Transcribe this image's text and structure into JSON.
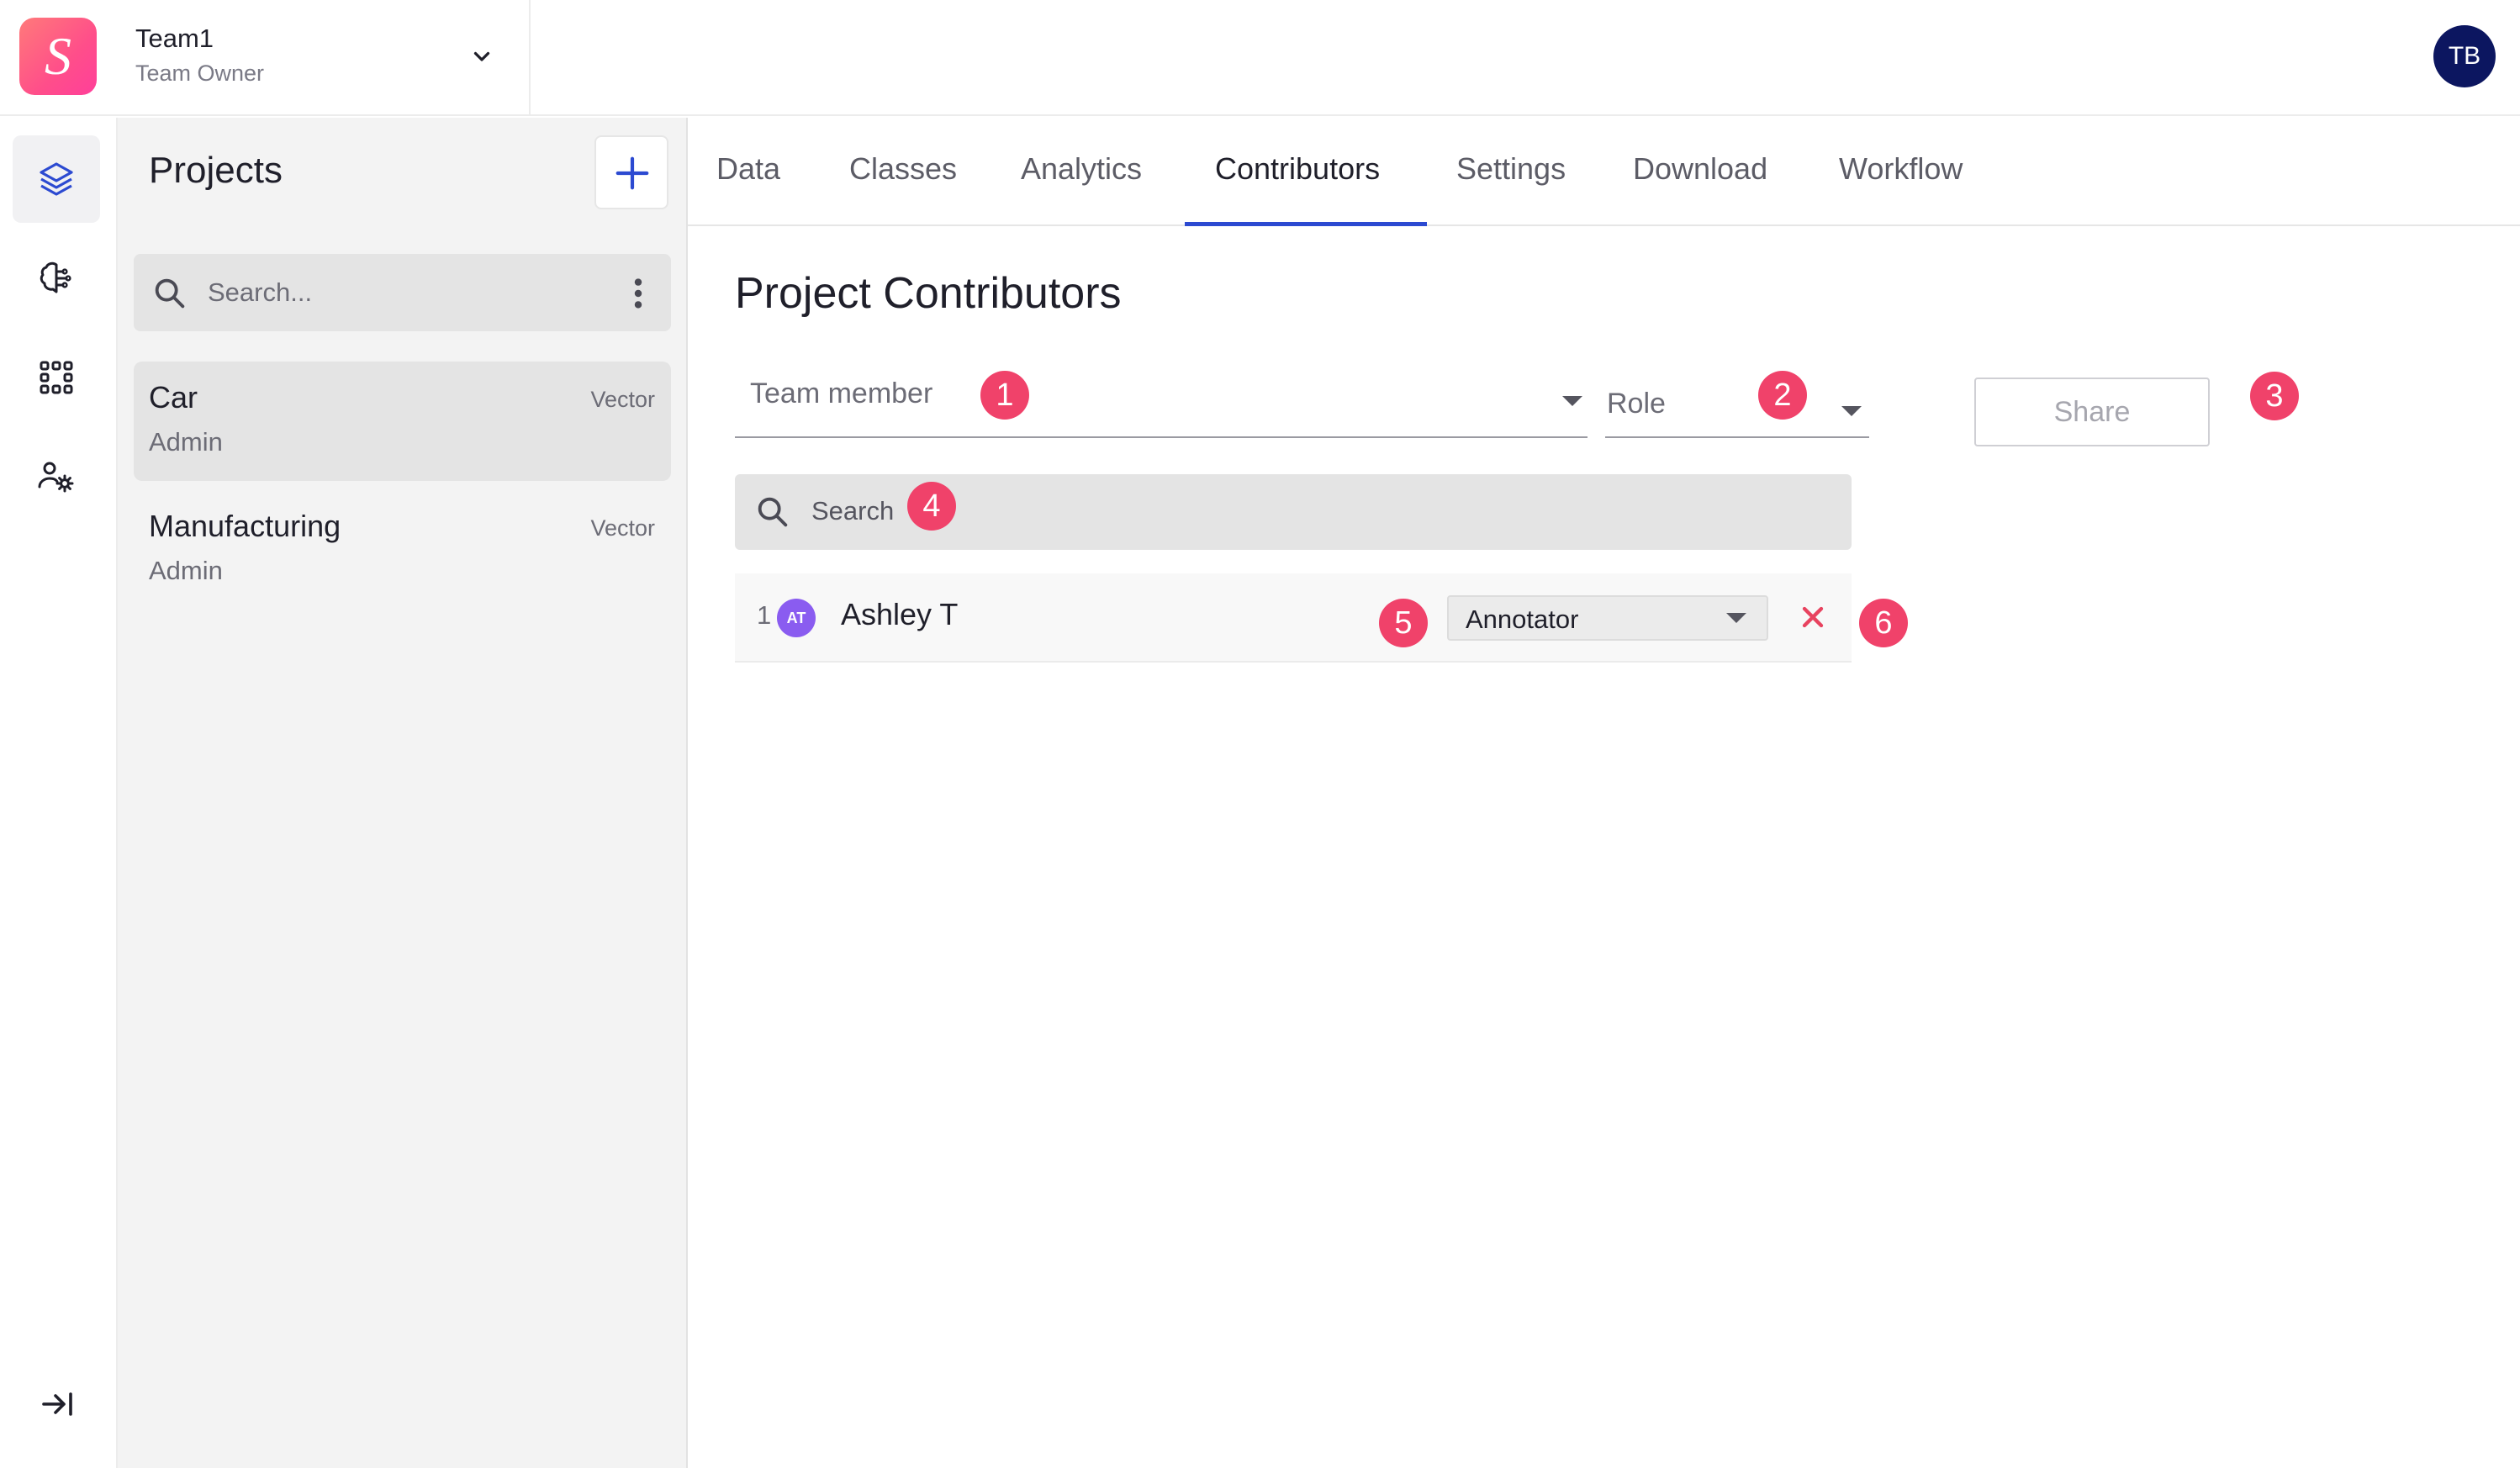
{
  "team": {
    "logo_letter": "S",
    "name": "Team1",
    "role": "Team Owner"
  },
  "user": {
    "initials": "TB"
  },
  "rail": {
    "items": [
      {
        "icon": "layers-icon"
      },
      {
        "icon": "brain-icon"
      },
      {
        "icon": "grid-icon"
      },
      {
        "icon": "users-settings-icon"
      }
    ],
    "collapse_icon": "collapse-right-icon"
  },
  "projects": {
    "title": "Projects",
    "search_placeholder": "Search...",
    "items": [
      {
        "name": "Car",
        "role": "Admin",
        "type": "Vector"
      },
      {
        "name": "Manufacturing",
        "role": "Admin",
        "type": "Vector"
      }
    ]
  },
  "tabs": [
    {
      "label": "Data"
    },
    {
      "label": "Classes"
    },
    {
      "label": "Analytics"
    },
    {
      "label": "Contributors"
    },
    {
      "label": "Settings"
    },
    {
      "label": "Download"
    },
    {
      "label": "Workflow"
    }
  ],
  "active_tab": "Contributors",
  "contributors": {
    "title": "Project Contributors",
    "team_member_label": "Team member",
    "role_label": "Role",
    "share_label": "Share",
    "search_placeholder": "Search",
    "rows": [
      {
        "index": "1",
        "initials": "AT",
        "name": "Ashley T",
        "role": "Annotator"
      }
    ]
  },
  "callouts": [
    "1",
    "2",
    "3",
    "4",
    "5",
    "6"
  ],
  "colors": {
    "accent": "#2c4ad1",
    "callout": "#f0426a",
    "avatar": "#0c1660",
    "remove": "#e8435f"
  }
}
